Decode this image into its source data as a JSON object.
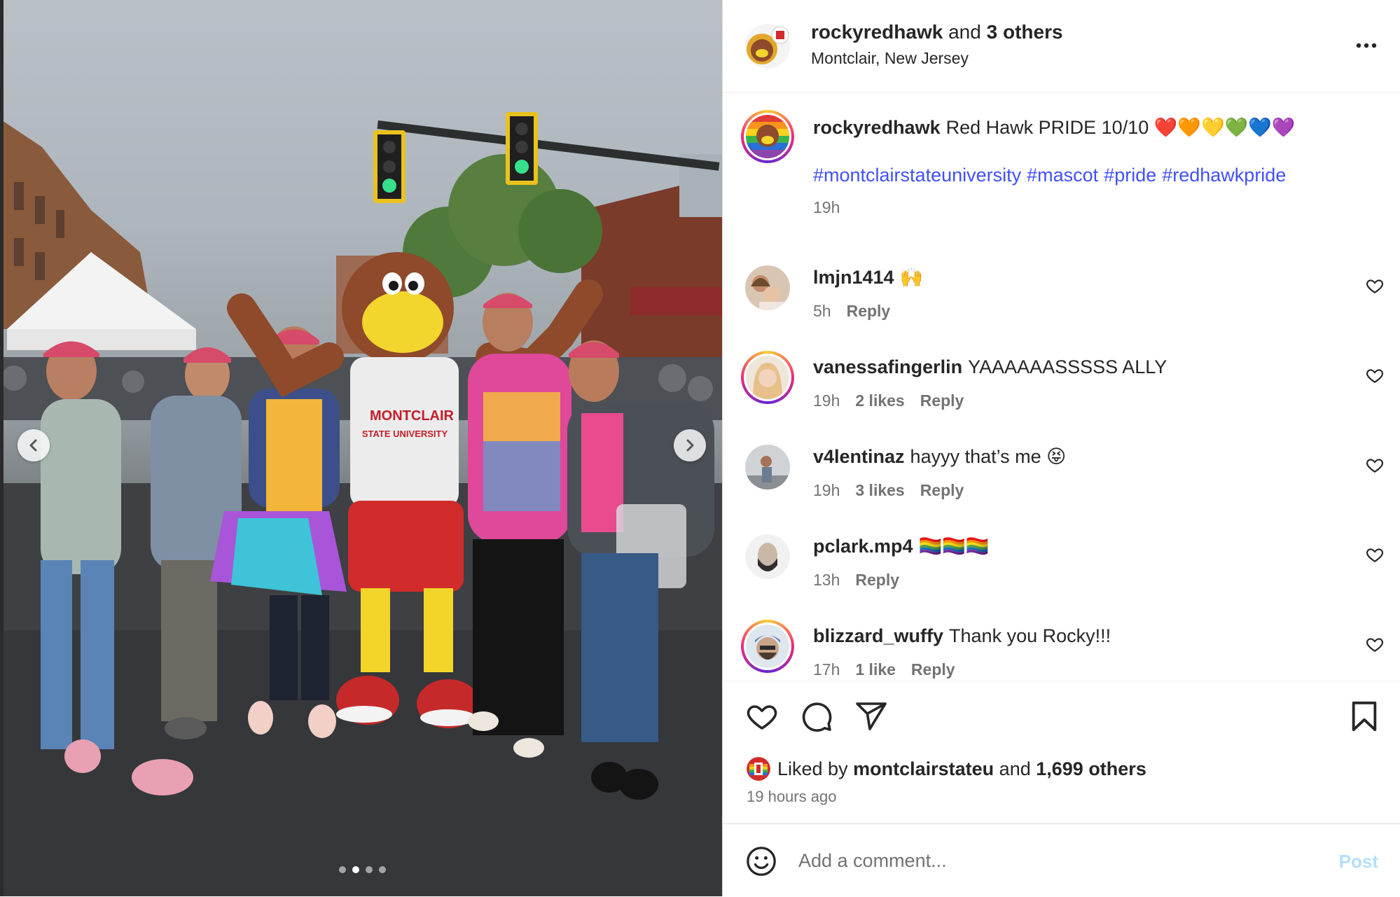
{
  "post": {
    "header": {
      "author": "rockyredhawk",
      "and_text": "and",
      "others": "3 others",
      "location": "Montclair, New Jersey"
    },
    "caption": {
      "user": "rockyredhawk",
      "text": "Red Hawk PRIDE 10/10 ❤️🧡💛💚💙💜",
      "hashtags": [
        "#montclairstateuniversity",
        "#mascot",
        "#pride",
        "#redhawkpride"
      ],
      "time": "19h"
    },
    "comments": [
      {
        "user": "lmjn1414",
        "text": "🙌",
        "time": "5h",
        "likes": "",
        "reply": "Reply"
      },
      {
        "user": "vanessafingerlin",
        "text": "YAAAAAASSSSS ALLY",
        "time": "19h",
        "likes": "2 likes",
        "reply": "Reply"
      },
      {
        "user": "v4lentinaz",
        "text": "hayyy that’s me 😝",
        "time": "19h",
        "likes": "3 likes",
        "reply": "Reply"
      },
      {
        "user": "pclark.mp4",
        "text": "🏳️‍🌈🏳️‍🌈🏳️‍🌈",
        "time": "13h",
        "likes": "",
        "reply": "Reply"
      },
      {
        "user": "blizzard_wuffy",
        "text": "Thank you Rocky!!!",
        "time": "17h",
        "likes": "1 like",
        "reply": "Reply"
      }
    ],
    "likes": {
      "prefix": "Liked by",
      "user": "montclairstateu",
      "and_text": "and",
      "others": "1,699 others"
    },
    "timestamp": "19 hours ago",
    "add_comment": {
      "placeholder": "Add a comment...",
      "post_label": "Post"
    },
    "photo": {
      "mascot_shirt_line1": "MONTCLAIR",
      "mascot_shirt_line2": "STATE UNIVERSITY",
      "carousel_count": 4,
      "carousel_active": 1
    },
    "colors": {
      "hashtag": "#4150f7",
      "post_disabled": "#b2dffc",
      "meta_gray": "#737373"
    }
  }
}
